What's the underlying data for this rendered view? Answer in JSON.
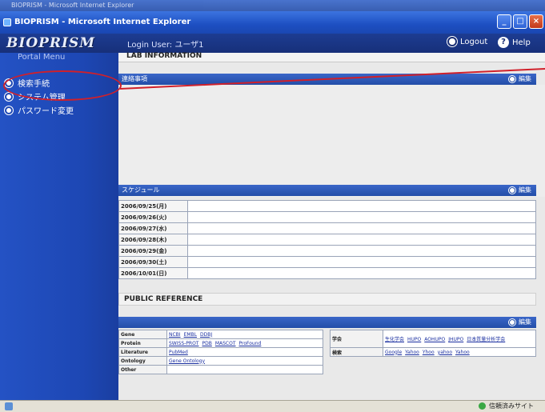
{
  "window": {
    "ghost_title": "BIOPRISM - Microsoft Internet Explorer",
    "title": "BIOPRISM - Microsoft Internet Explorer",
    "min": "_",
    "max": "□",
    "close": "×"
  },
  "header": {
    "logo": "BIOPRISM",
    "login_user": "Login User: ユーザ1",
    "logout": "Logout",
    "help": "Help",
    "help_glyph": "?"
  },
  "sidebar": {
    "portal_label": "Portal Menu",
    "items": [
      {
        "label": "検索手続"
      },
      {
        "label": "システム管理"
      },
      {
        "label": "パスワード変更"
      }
    ]
  },
  "main": {
    "info_strip": "LAB INFORMATION",
    "notice": {
      "title": "連絡事項",
      "edit": "編集"
    },
    "schedule": {
      "title": "スケジュール",
      "edit": "編集",
      "dates": [
        "2006/09/25(月)",
        "2006/09/26(火)",
        "2006/09/27(水)",
        "2006/09/28(木)",
        "2006/09/29(金)",
        "2006/09/30(土)",
        "2006/10/01(日)"
      ]
    },
    "public_reference": {
      "title": "PUBLIC REFERENCE",
      "edit": "編集",
      "left_rows": [
        {
          "label": "Gene",
          "links": [
            "NCBI",
            "EMBL",
            "DDBJ"
          ]
        },
        {
          "label": "Protein",
          "links": [
            "SWISS-PROT",
            "PDB",
            "MASCOT",
            "ProFound"
          ]
        },
        {
          "label": "Literature",
          "links": [
            "PubMed"
          ]
        },
        {
          "label": "Ontology",
          "links": [
            "Gene Ontology"
          ]
        },
        {
          "label": "Other",
          "links": []
        }
      ],
      "right_rows": [
        {
          "label": "学会",
          "links": [
            "生化学会",
            "HUPO",
            "AOHUPO",
            "JHUPO",
            "日本質量分析学会"
          ]
        },
        {
          "label": "検索",
          "links": [
            "Google",
            "Yahoo",
            "Yhoo",
            "yahoo",
            "Yahoo"
          ]
        }
      ]
    }
  },
  "status_bar": {
    "zone": "信頼済みサイト"
  }
}
